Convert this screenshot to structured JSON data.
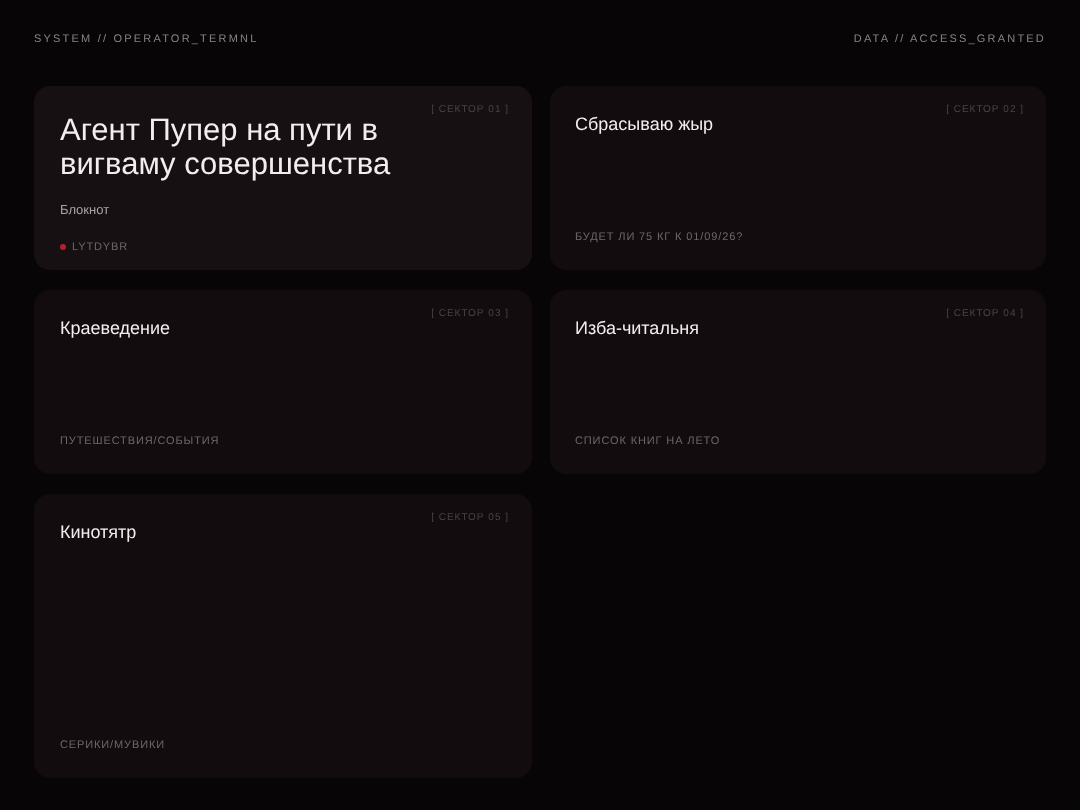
{
  "header": {
    "left": "SYSTEM // OPERATOR_TERMNL",
    "right": "DATA // ACCESS_GRANTED"
  },
  "cards": [
    {
      "kind": "featured",
      "sector": "[ СЕКТОР 01 ]",
      "title": "Агент Пупер на пути в вигваму совершенства",
      "subtitle": "Блокнот",
      "tag": "LYTDYBR"
    },
    {
      "kind": "standard",
      "sector": "[ СЕКТОР 02 ]",
      "title": "Сбрасываю жыр",
      "footer": "БУДЕТ ЛИ 75 КГ К 01/09/26?"
    },
    {
      "kind": "standard",
      "sector": "[ СЕКТОР 03 ]",
      "title": "Краеведение",
      "footer": "ПУТЕШЕСТВИЯ/СОБЫТИЯ"
    },
    {
      "kind": "standard",
      "sector": "[ СЕКТОР 04 ]",
      "title": "Изба-читальня",
      "footer": "СПИСОК КНИГ НА ЛЕТО"
    },
    {
      "kind": "standard",
      "sector": "[ СЕКТОР 05 ]",
      "title": "Кинотятр",
      "footer": "СЕРИКИ/МУВИКИ"
    }
  ]
}
